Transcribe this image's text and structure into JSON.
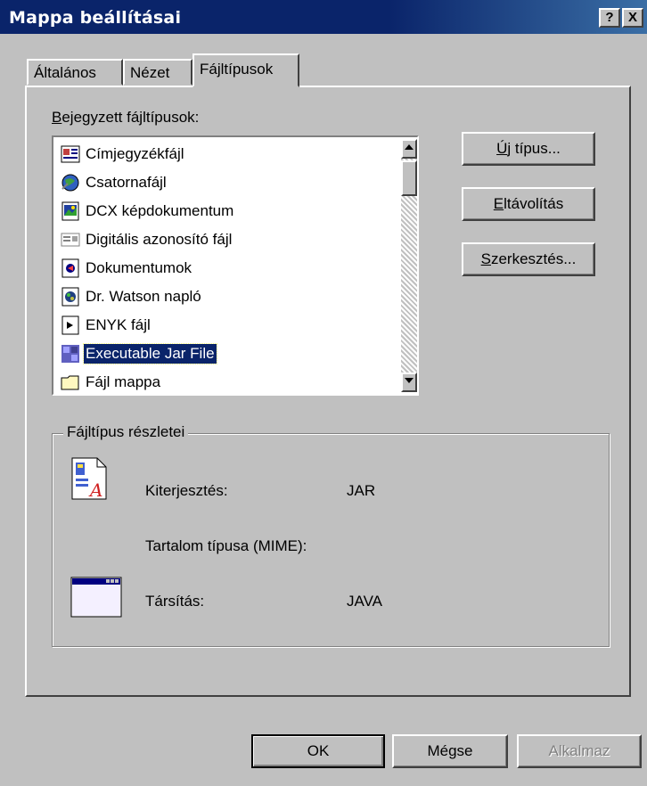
{
  "window": {
    "title": "Mappa beállításai",
    "help_label": "?",
    "close_label": "X"
  },
  "tabs": [
    {
      "label": "Általános",
      "active": false
    },
    {
      "label": "Nézet",
      "active": false
    },
    {
      "label": "Fájltípusok",
      "active": true
    }
  ],
  "filetypes": {
    "label": "Bejegyzett fájltípusok:",
    "items": [
      {
        "label": "Címjegyzékfájl",
        "icon": "address-book-icon"
      },
      {
        "label": "Csatornafájl",
        "icon": "channel-globe-icon"
      },
      {
        "label": "DCX képdokumentum",
        "icon": "image-document-icon"
      },
      {
        "label": "Digitális azonosító fájl",
        "icon": "certificate-icon"
      },
      {
        "label": "Dokumentumok",
        "icon": "documents-icon"
      },
      {
        "label": "Dr. Watson napló",
        "icon": "log-file-icon"
      },
      {
        "label": "ENYK fájl",
        "icon": "enyk-file-icon"
      },
      {
        "label": "Executable Jar File",
        "icon": "jar-file-icon",
        "selected": true
      },
      {
        "label": "Fájl mappa",
        "icon": "folder-icon"
      }
    ]
  },
  "buttons": {
    "new_type": "Új típus...",
    "remove": "Eltávolítás",
    "edit": "Szerkesztés..."
  },
  "details": {
    "legend": "Fájltípus részletei",
    "extension_label": "Kiterjesztés:",
    "extension_value": "JAR",
    "mime_label": "Tartalom típusa (MIME):",
    "mime_value": "",
    "assoc_label": "Társítás:",
    "assoc_value": "JAVA"
  },
  "footer": {
    "ok": "OK",
    "cancel": "Mégse",
    "apply": "Alkalmaz"
  },
  "colors": {
    "titlebar": "#0a246a",
    "face": "#c0c0c0",
    "selection": "#0a246a"
  }
}
